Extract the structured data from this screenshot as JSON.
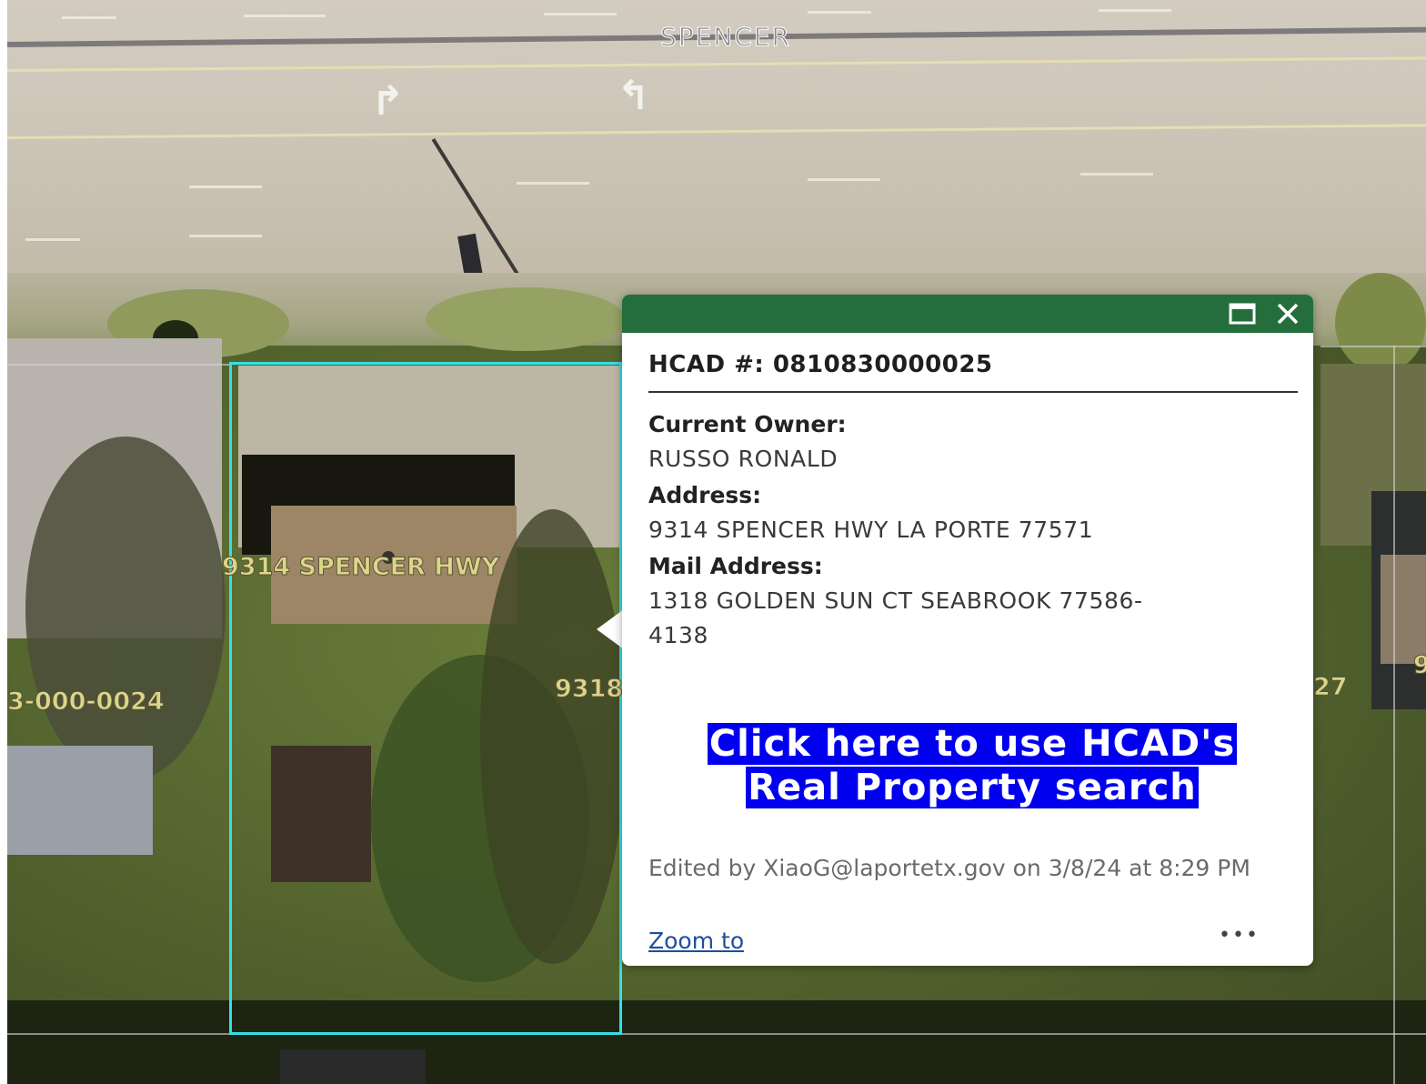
{
  "map": {
    "street_label": "SPENCER",
    "parcel_label_main": "9314 SPENCER HWY",
    "parcel_label_left": "3-000-0024",
    "parcel_label_right": "9318",
    "parcel_label_far_right": "27",
    "parcel_label_edge": "9",
    "parcel_outline_color": "#33e0e6"
  },
  "popup": {
    "header_color": "#236e3b",
    "maximize_icon": "maximize-icon",
    "close_icon": "close-icon",
    "title": "HCAD #: 0810830000025",
    "fields": [
      {
        "label": "Current Owner:",
        "value": "RUSSO RONALD"
      },
      {
        "label": "Address:",
        "value": "9314 SPENCER HWY LA PORTE 77571"
      },
      {
        "label": "Mail Address:",
        "value": "1318 GOLDEN SUN CT SEABROOK 77586-",
        "value_cont": "4138"
      }
    ],
    "link_line1": "Click here to use HCAD's",
    "link_line2": "Real Property search",
    "link_color": "#0000ee",
    "edited": "Edited by XiaoG@laportetx.gov on 3/8/24 at 8:29 PM",
    "zoom_to": "Zoom to",
    "more": "•••"
  }
}
